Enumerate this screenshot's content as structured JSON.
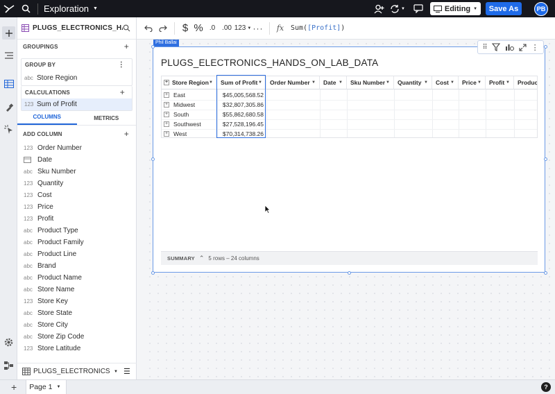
{
  "topbar": {
    "title": "Exploration",
    "editing_label": "Editing",
    "save_as_label": "Save As",
    "avatar_initials": "PB"
  },
  "panel": {
    "source_name": "PLUGS_ELECTRONICS_HAN...",
    "groupings_label": "GROUPINGS",
    "group_by_label": "GROUP BY",
    "group_by_item": {
      "type": "abc",
      "name": "Store Region"
    },
    "calculations_label": "CALCULATIONS",
    "calc_item": {
      "type": "123",
      "name": "Sum of Profit"
    },
    "tabs": [
      "COLUMNS",
      "METRICS"
    ],
    "add_column_label": "ADD COLUMN",
    "columns": [
      {
        "type": "123",
        "name": "Order Number"
      },
      {
        "type": "date",
        "name": "Date"
      },
      {
        "type": "abc",
        "name": "Sku Number"
      },
      {
        "type": "123",
        "name": "Quantity"
      },
      {
        "type": "123",
        "name": "Cost"
      },
      {
        "type": "123",
        "name": "Price"
      },
      {
        "type": "123",
        "name": "Profit"
      },
      {
        "type": "abc",
        "name": "Product Type"
      },
      {
        "type": "abc",
        "name": "Product Family"
      },
      {
        "type": "abc",
        "name": "Product Line"
      },
      {
        "type": "abc",
        "name": "Brand"
      },
      {
        "type": "abc",
        "name": "Product Name"
      },
      {
        "type": "abc",
        "name": "Store Name"
      },
      {
        "type": "123",
        "name": "Store Key"
      },
      {
        "type": "abc",
        "name": "Store State"
      },
      {
        "type": "abc",
        "name": "Store City"
      },
      {
        "type": "abc",
        "name": "Store Zip Code"
      },
      {
        "type": "123",
        "name": "Store Latitude"
      }
    ],
    "bottom_source": "PLUGS_ELECTRONICS_H..."
  },
  "formula_bar": {
    "format_currency": "$",
    "format_percent": "%",
    "decimals_less": ".0",
    "decimals_more": ".00",
    "number_format": "123",
    "fx_label": "fx",
    "formula_fn": "Sum(",
    "formula_arg": "[Profit]",
    "formula_close": ")"
  },
  "element": {
    "owner": "Phil Ballai",
    "title": "PLUGS_ELECTRONICS_HANDS_ON_LAB_DATA",
    "headers": [
      "Store Region",
      "Sum of Profit",
      "Order Number",
      "Date",
      "Sku Number",
      "Quantity",
      "Cost",
      "Price",
      "Profit",
      "Produc"
    ],
    "rows": [
      {
        "region": "East",
        "profit": "$45,005,568.52"
      },
      {
        "region": "Midwest",
        "profit": "$32,807,305.86"
      },
      {
        "region": "South",
        "profit": "$55,862,680.58"
      },
      {
        "region": "Southwest",
        "profit": "$27,528,196.45"
      },
      {
        "region": "West",
        "profit": "$70,314,738.26"
      }
    ],
    "summary_label": "SUMMARY",
    "summary_info": "5 rows – 24 columns"
  },
  "bottom": {
    "page_label": "Page 1",
    "help": "?"
  },
  "colors": {
    "accent": "#1f6be8",
    "topbar": "#16171d"
  }
}
